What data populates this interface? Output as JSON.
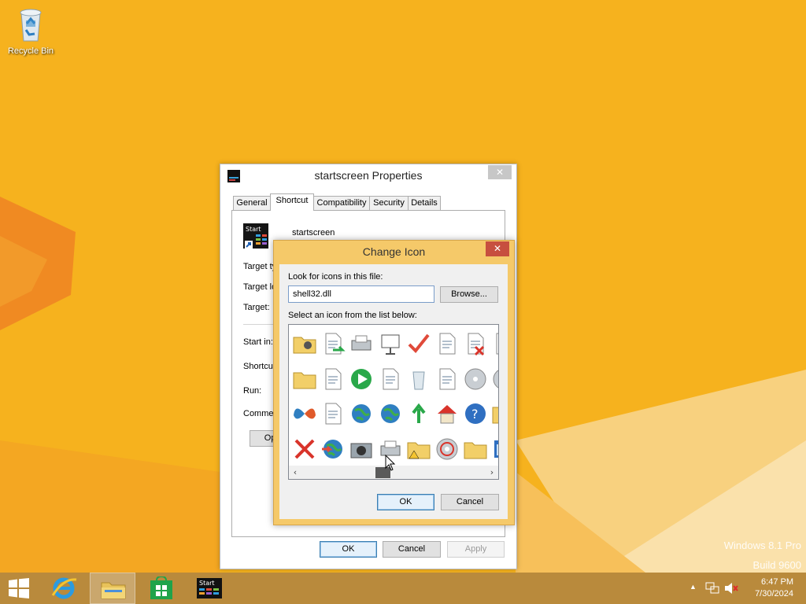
{
  "desktop": {
    "recycle_bin_label": "Recycle Bin",
    "watermark_line1": "Windows 8.1 Pro",
    "watermark_line2": "Build 9600"
  },
  "properties": {
    "title": "startscreen Properties",
    "close_icon": "close-icon",
    "tabs": [
      "General",
      "Shortcut",
      "Compatibility",
      "Security",
      "Details"
    ],
    "active_tab": "Shortcut",
    "shortcut_name": "startscreen",
    "app_icon_text": "Start",
    "field_labels": [
      "Target ty",
      "Target lo",
      "Target:",
      "Start in:",
      "Shortcut",
      "Run:",
      "Commen"
    ],
    "open_button_partial": "Oper",
    "buttons": {
      "ok": "OK",
      "cancel": "Cancel",
      "apply": "Apply"
    }
  },
  "change_icon": {
    "title": "Change Icon",
    "look_label": "Look for icons in this file:",
    "file_value": "shell32.dll",
    "browse_label": "Browse...",
    "select_label": "Select an icon from the list below:",
    "icons": [
      "media-folder-icon",
      "file-move-icon",
      "printer-icon",
      "projector-screen-icon",
      "checkmark-icon",
      "network-computers-icon",
      "checklist-x-icon",
      "document-icon",
      "scroll-folder-icon",
      "network-adapter-icon",
      "play-icon",
      "magnifier-computer-icon",
      "recycle-bin-icon",
      "add-programs-icon",
      "disc-search-icon",
      "disc-icon",
      "butterfly-icon",
      "documents-icon",
      "globe-icon",
      "globe-picture-icon",
      "green-arrow-up-icon",
      "home-network-icon",
      "help-icon",
      "folder-icon",
      "red-x-icon",
      "globe-arrow-icon",
      "camera-icon",
      "scanner-icon",
      "folder-warning-icon",
      "cd-icon",
      "folder-icon",
      "blue-window-icon"
    ],
    "buttons": {
      "ok": "OK",
      "cancel": "Cancel"
    }
  },
  "taskbar": {
    "start_icon": "windows-start-icon",
    "pinned": [
      "internet-explorer-icon",
      "file-explorer-icon",
      "store-icon",
      "startscreen-app-icon"
    ],
    "app_icon_text": "Start",
    "clock_time": "6:47 PM",
    "clock_date": "7/30/2024"
  },
  "colors": {
    "desktop_bg": "#f6b21e",
    "dialog_frame": "#f5c969",
    "close_red": "#c74f3f",
    "taskbar": "#b98a3c"
  }
}
